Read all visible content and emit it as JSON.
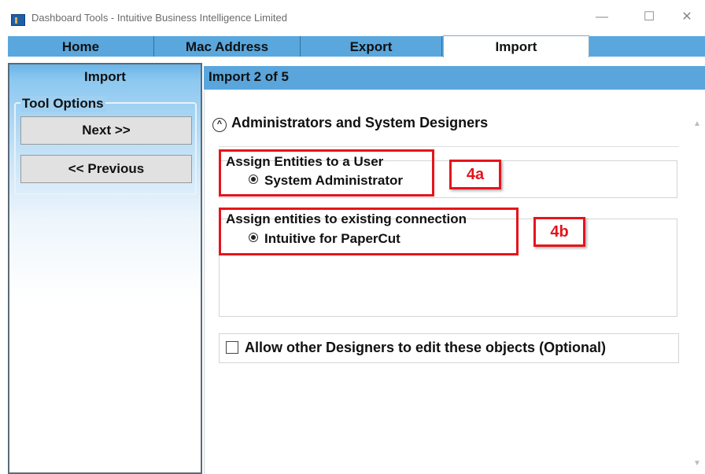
{
  "window": {
    "title": "Dashboard Tools - Intuitive Business Intelligence Limited",
    "minimize_glyph": "—",
    "maximize_glyph": "☐",
    "close_glyph": "✕"
  },
  "tabs": [
    {
      "label": "Home"
    },
    {
      "label": "Mac Address"
    },
    {
      "label": "Export"
    },
    {
      "label": "Import"
    }
  ],
  "sidebar": {
    "title": "Import",
    "group_label": "Tool Options",
    "next_label": "Next >>",
    "previous_label": "<< Previous"
  },
  "main": {
    "header": "Import 2 of 5",
    "section_title": "Administrators and System Designers",
    "group_a": {
      "label": "Assign Entities to a User",
      "option": "System Administrator",
      "callout": "4a"
    },
    "group_b": {
      "label": "Assign entities to existing connection",
      "option": "Intuitive for PaperCut",
      "callout": "4b"
    },
    "checkbox_label": "Allow other Designers to edit these objects (Optional)"
  },
  "colors": {
    "accent_blue": "#5aa6dc",
    "annotation_red": "#e5141c"
  },
  "icons": {
    "collapse": "chevron-up-circle-icon",
    "app": "app-icon"
  }
}
